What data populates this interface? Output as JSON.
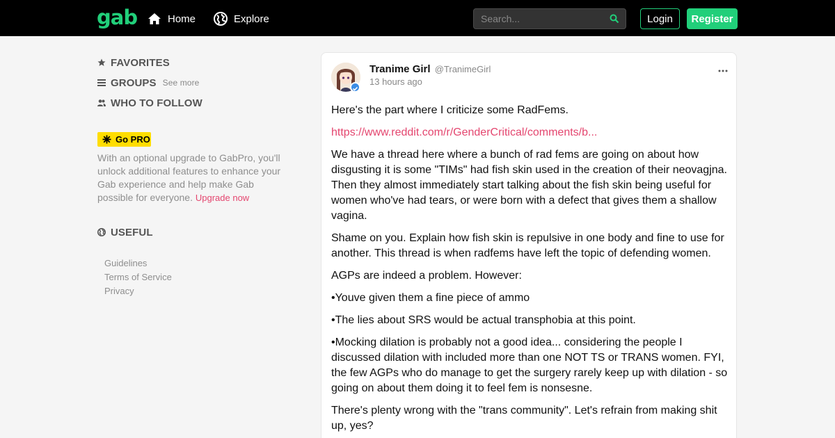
{
  "topbar": {
    "logo": "gab",
    "nav": {
      "home": "Home",
      "explore": "Explore"
    },
    "search_placeholder": "Search...",
    "login": "Login",
    "register": "Register"
  },
  "sidebar": {
    "favorites": "FAVORITES",
    "groups": "GROUPS",
    "see_more": "See more",
    "who_to_follow": "WHO TO FOLLOW",
    "gopro": {
      "badge": "Go PRO",
      "text": "With an optional upgrade to GabPro, you'll unlock additional features to enhance your Gab experience and help make Gab possible for everyone.",
      "upgrade_link": "Upgrade now"
    },
    "useful": "USEFUL",
    "links": [
      "Guidelines",
      "Terms of Service",
      "Privacy"
    ]
  },
  "post": {
    "author": "Tranime Girl",
    "handle": "@TranimeGirl",
    "time": "13 hours ago",
    "paragraphs": [
      "Here's the part where I criticize some RadFems.",
      "https://www.reddit.com/r/GenderCritical/comments/b...",
      "We have a thread here where a bunch of rad fems are going on about how disgusting it is some \"TIMs\" had fish skin used in the creation of their neovagjna. Then they almost immediately start talking about the fish skin being useful for women who've had tears, or were born with a defect that gives them a shallow vagina.",
      "Shame on you. Explain how fish skin is repulsive in one body and fine to use for another. This thread is when radfems have left the topic of defending women.",
      "AGPs are indeed a problem. However:",
      "•Youve given them a fine piece of ammo",
      "•The lies about SRS would be actual transphobia at this point.",
      "•Mocking dilation is probably not a good idea... considering the people I discussed dilation with included more than one NOT TS or TRANS women. FYI, the few AGPs who do manage to get the surgery rarely keep up with dilation - so going on about them doing it to feel fem is nonsesne.",
      "There's plenty wrong with the \"trans community\". Let's refrain from making shit up, yes?"
    ]
  },
  "colors": {
    "brand_green": "#21cf7a",
    "link_pink": "#e4466f",
    "pro_yellow": "#ffdd00",
    "topbar_bg": "#000000",
    "page_bg": "#f5f5f5",
    "verified_blue": "#3b8de6"
  },
  "icons": {
    "home": "home-icon",
    "explore": "globe-icon",
    "search": "search-icon",
    "favorites": "star-icon",
    "groups": "list-icon",
    "who_to_follow": "users-icon",
    "gopro": "sparkle-icon",
    "useful": "globe-icon",
    "more": "ellipsis-icon",
    "verified": "verified-check-icon"
  }
}
